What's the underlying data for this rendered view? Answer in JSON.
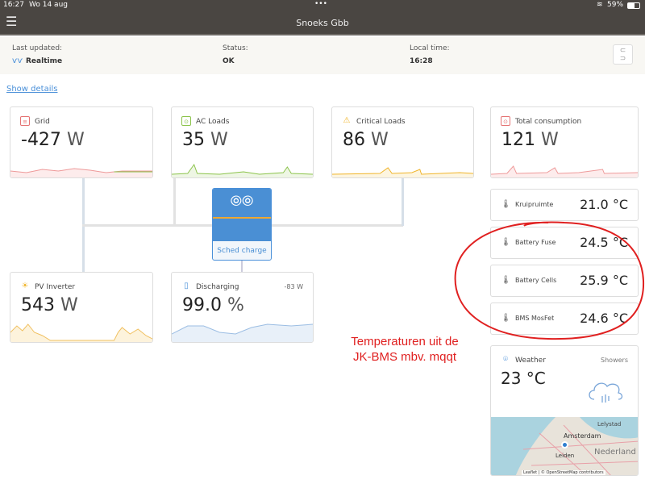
{
  "statusbar": {
    "time": "16:27",
    "date": "Wo 14 aug",
    "battery": "59%"
  },
  "header": {
    "title": "Snoeks Gbb"
  },
  "info": {
    "last_updated_label": "Last updated:",
    "last_updated_value": "Realtime",
    "status_label": "Status:",
    "status_value": "OK",
    "local_time_label": "Local time:",
    "local_time_value": "16:28"
  },
  "show_details": "Show details",
  "cards": {
    "grid": {
      "title": "Grid",
      "value": "-427",
      "unit": "W",
      "color": "#e57373"
    },
    "ac_loads": {
      "title": "AC Loads",
      "value": "35",
      "unit": "W",
      "color": "#8bc34a"
    },
    "critical_loads": {
      "title": "Critical Loads",
      "value": "86",
      "unit": "W",
      "color": "#f0b429"
    },
    "total": {
      "title": "Total consumption",
      "value": "121",
      "unit": "W",
      "color": "#e57373"
    },
    "pv": {
      "title": "PV Inverter",
      "value": "543",
      "unit": "W",
      "color": "#f0b429"
    },
    "battery": {
      "title": "Discharging",
      "power": "-83 W",
      "value": "99.0",
      "unit": "%",
      "color": "#4a90d9"
    }
  },
  "inverter": {
    "mode": "Sched charge"
  },
  "temperatures": [
    {
      "name": "Kruipruimte",
      "value": "21.0 °C"
    },
    {
      "name": "Battery Fuse",
      "value": "24.5 °C"
    },
    {
      "name": "Battery Cells",
      "value": "25.9 °C"
    },
    {
      "name": "BMS MosFet",
      "value": "24.6 °C"
    }
  ],
  "weather": {
    "title": "Weather",
    "condition": "Showers",
    "value": "23 °C",
    "map_labels": [
      "Lelystad",
      "Amsterdam",
      "Leiden",
      "Nederland"
    ],
    "attribution": "Leaflet | © OpenStreetMap contributors"
  },
  "annotation": {
    "line1": "Temperaturen uit de",
    "line2": "JK-BMS mbv. mqqt",
    "color": "#e02020"
  }
}
